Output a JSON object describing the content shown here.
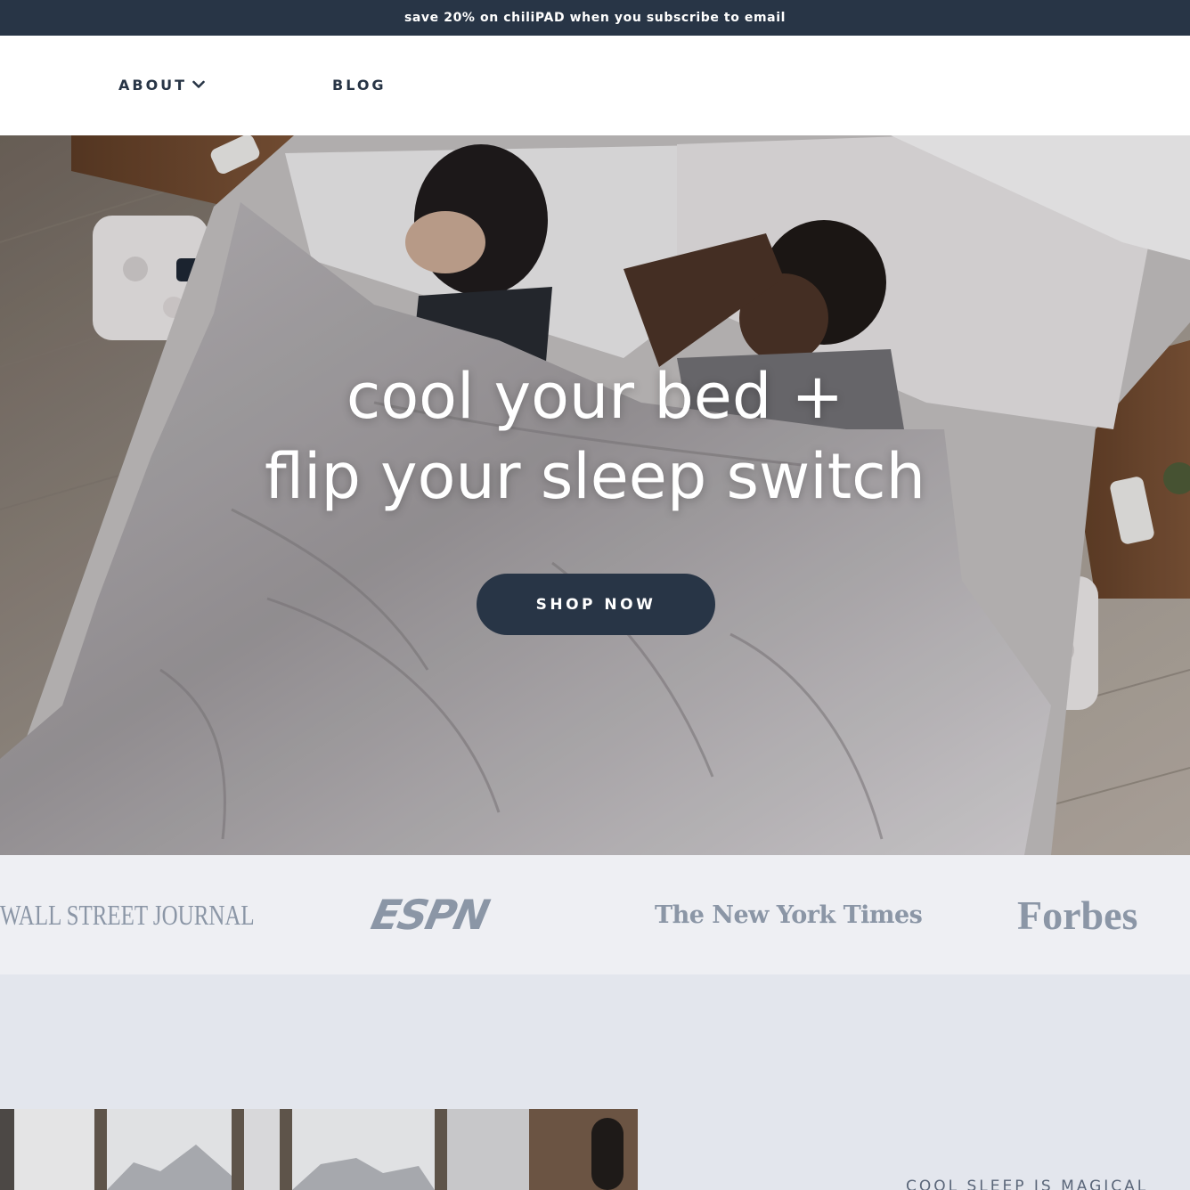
{
  "announcement": {
    "text": "save 20% on chiliPAD when you subscribe to email"
  },
  "nav": {
    "items": [
      {
        "label": "ABOUT",
        "has_dropdown": true,
        "icon": "chevron-down-icon"
      },
      {
        "label": "BLOG"
      }
    ]
  },
  "hero": {
    "headline_line1": "cool your bed +",
    "headline_line2": "flip your sleep switch",
    "cta_label": "SHOP NOW",
    "image": "couple-sleeping-in-bed-overhead-photo"
  },
  "press": {
    "logos": [
      {
        "name": "WALL STREET JOURNAL"
      },
      {
        "name": "ESPN"
      },
      {
        "name": "The New York Times"
      },
      {
        "name": "Forbes"
      }
    ]
  },
  "feature": {
    "heading": "COOL SLEEP IS MAGICAL",
    "image": "bedroom-mountain-view-photo"
  },
  "colors": {
    "brand_navy": "#283546",
    "press_bg": "#eeeff3",
    "feature_bg": "#e3e6ed",
    "logo_gray": "#8b96a6"
  }
}
